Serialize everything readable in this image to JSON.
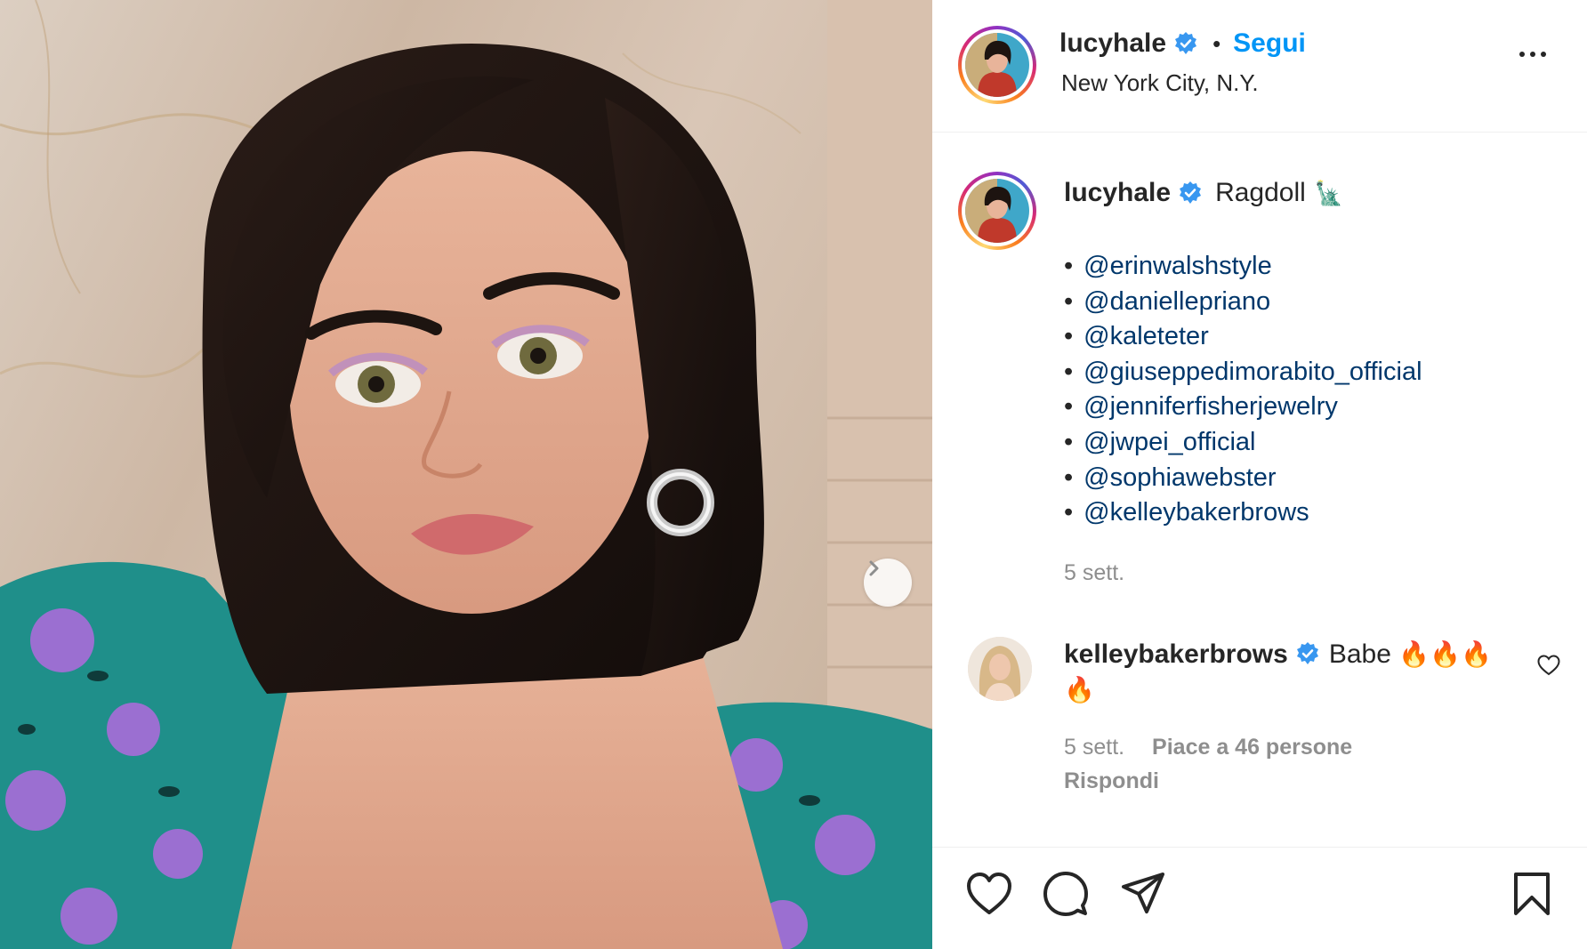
{
  "post": {
    "author": "lucyhale",
    "follow_label": "Segui",
    "separator": "•",
    "location": "New York City, N.Y."
  },
  "caption": {
    "author": "lucyhale",
    "text": "Ragdoll",
    "emoji": "🗽",
    "mentions": [
      "@erinwalshstyle",
      "@daniellepriano",
      "@kaleteter",
      "@giuseppedimorabito_official",
      "@jenniferfisherjewelry",
      "@jwpei_official",
      "@sophiawebster",
      "@kelleybakerbrows"
    ],
    "time": "5 sett."
  },
  "comment": {
    "author": "kelleybakerbrows",
    "text": "Babe",
    "fire_emoji": "🔥",
    "fire_count": 4,
    "time": "5 sett.",
    "likes": "Piace a 46 persone",
    "reply_label": "Rispondi"
  },
  "colors": {
    "accent_blue": "#0095f6",
    "mention_blue": "#00376b",
    "verified_blue": "#3897f0",
    "meta_gray": "#8e8e8e"
  },
  "icons": {
    "verified": "verified-badge-icon",
    "more": "more-options-icon",
    "next": "chevron-right-icon",
    "like": "heart-icon",
    "comment": "comment-icon",
    "share": "paper-plane-icon",
    "save": "bookmark-icon"
  }
}
